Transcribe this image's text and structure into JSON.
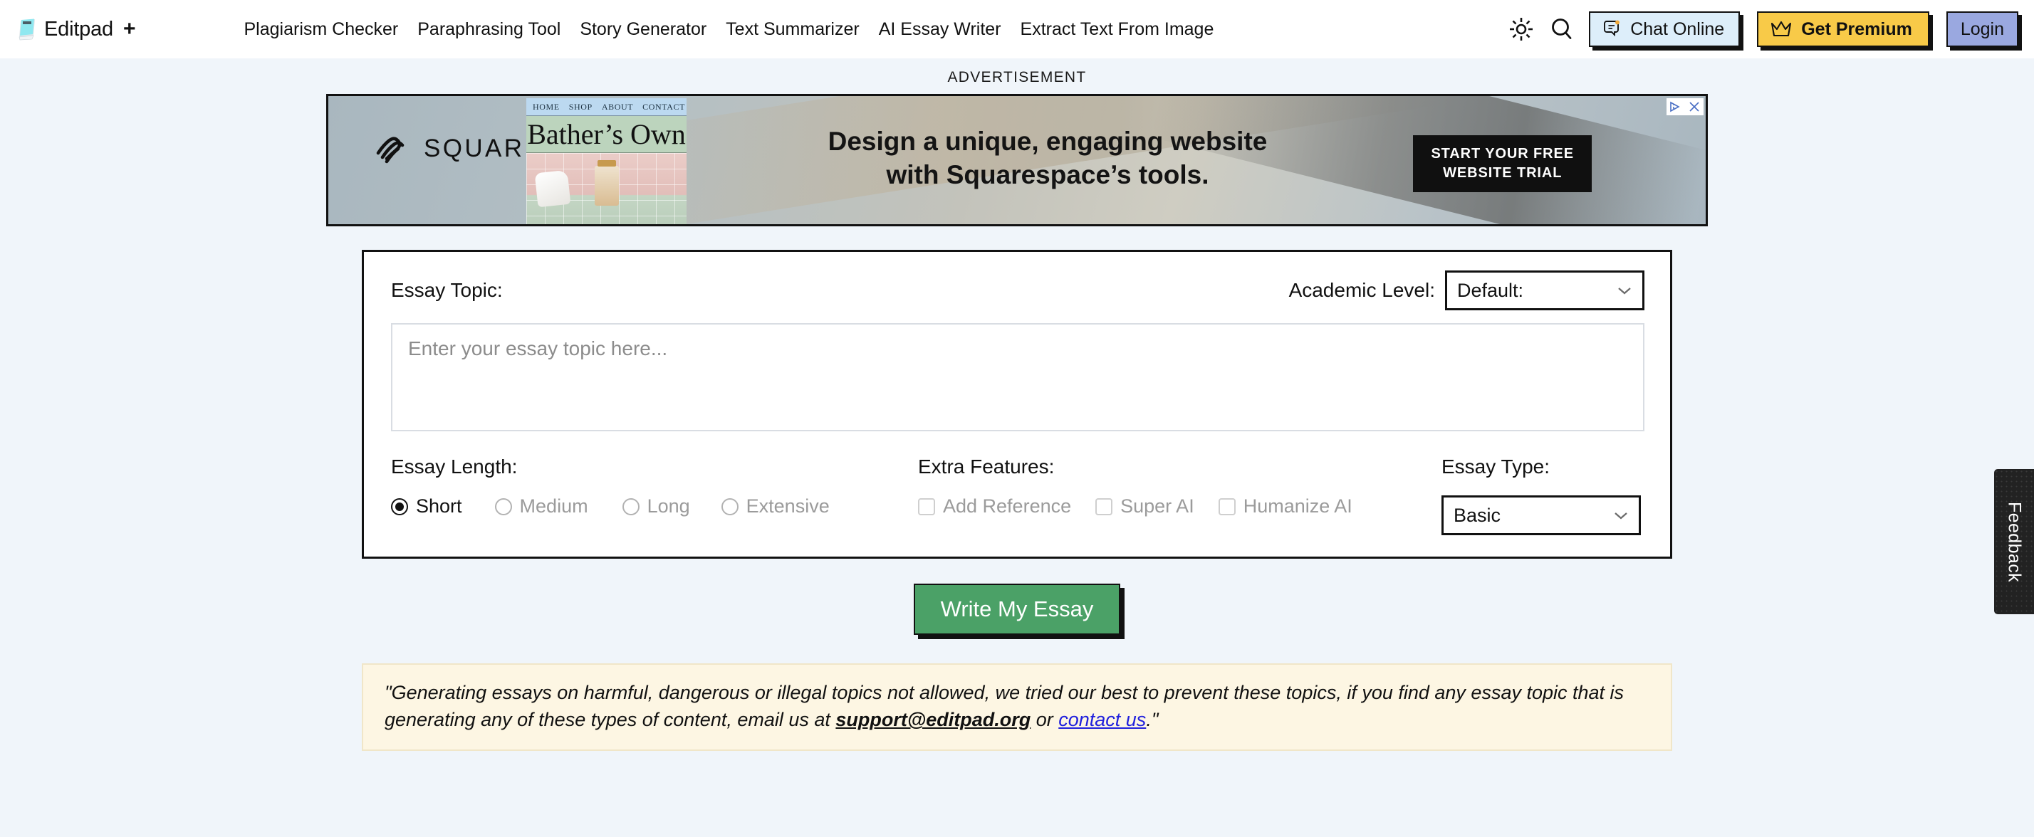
{
  "header": {
    "brand": {
      "name": "Editpad",
      "plus": "+",
      "logo_icon": "notepad-icon"
    },
    "nav": [
      {
        "label": "Plagiarism Checker"
      },
      {
        "label": "Paraphrasing Tool"
      },
      {
        "label": "Story Generator"
      },
      {
        "label": "Text Summarizer"
      },
      {
        "label": "AI Essay Writer"
      },
      {
        "label": "Extract Text From Image"
      }
    ],
    "theme_icon": "sun-icon",
    "search_icon": "search-icon",
    "chat": {
      "label": "Chat Online",
      "icon": "chat-bubble-icon",
      "bg": "#ddeefa"
    },
    "premium": {
      "label": "Get Premium",
      "icon": "crown-icon",
      "bg": "#f8ca48"
    },
    "login": {
      "label": "Login",
      "bg": "#9aa8e0"
    }
  },
  "ad": {
    "label": "ADVERTISEMENT",
    "brand": "SQUARESPACE",
    "headline_line1": "Design a unique, engaging website",
    "headline_line2": "with Squarespace’s tools.",
    "cta_line1": "START YOUR FREE",
    "cta_line2": "WEBSITE TRIAL",
    "site_preview": {
      "nav": [
        "HOME",
        "SHOP",
        "ABOUT",
        "CONTACT"
      ],
      "title": "Bather’s Own"
    },
    "badges": [
      "adchoices-icon",
      "close-icon"
    ]
  },
  "form": {
    "topic_label": "Essay Topic:",
    "topic_placeholder": "Enter your essay topic here...",
    "topic_value": "",
    "academic_label": "Academic Level:",
    "academic_value": "Default:",
    "length_label": "Essay Length:",
    "length_options": [
      {
        "label": "Short",
        "selected": true,
        "disabled": false
      },
      {
        "label": "Medium",
        "selected": false,
        "disabled": true
      },
      {
        "label": "Long",
        "selected": false,
        "disabled": true
      },
      {
        "label": "Extensive",
        "selected": false,
        "disabled": true
      }
    ],
    "extra_label": "Extra Features:",
    "extra_options": [
      {
        "label": "Add Reference",
        "checked": false,
        "disabled": true
      },
      {
        "label": "Super AI",
        "checked": false,
        "disabled": true
      },
      {
        "label": "Humanize AI",
        "checked": false,
        "disabled": true
      }
    ],
    "type_label": "Essay Type:",
    "type_value": "Basic",
    "submit_label": "Write My Essay",
    "submit_color": "#4ba167"
  },
  "notice": {
    "part1": "\"Generating essays on harmful, dangerous or illegal topics not allowed, we tried our best to prevent these topics, if you find any essay topic that is generating any of these types of content, email us at ",
    "email": "support@editpad.org",
    "part2": " or ",
    "contact": "contact us",
    "part3": ".\""
  },
  "feedback": {
    "label": "Feedback"
  }
}
